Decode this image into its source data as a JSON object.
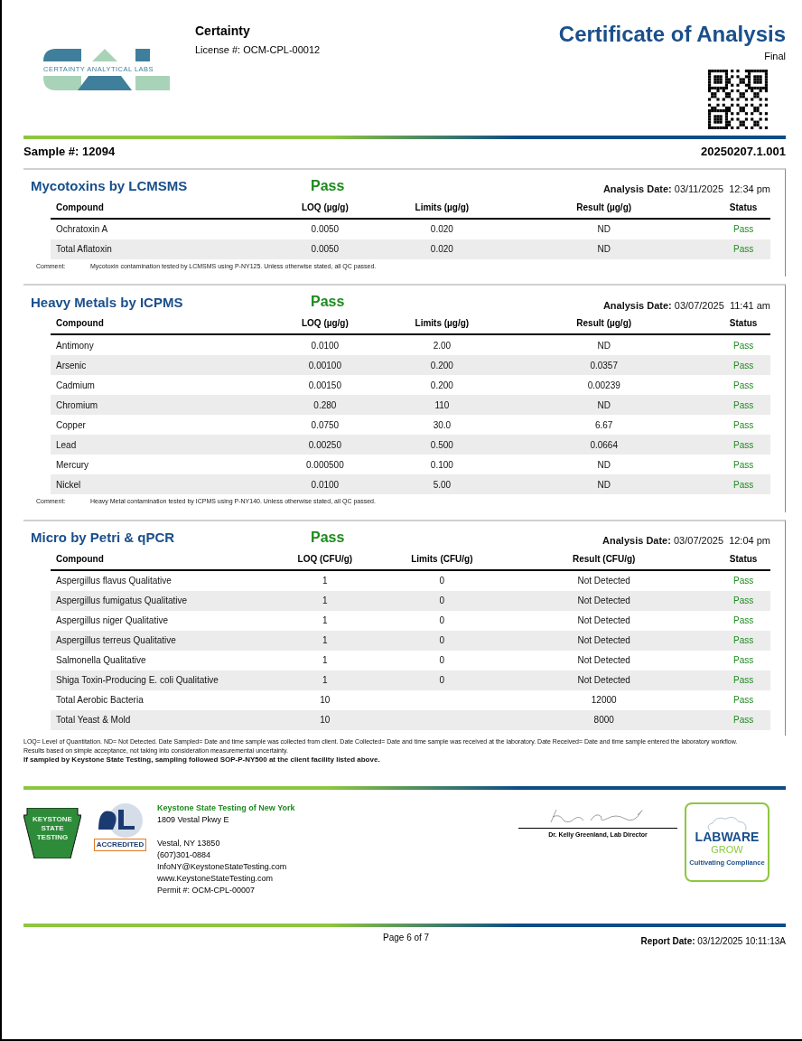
{
  "header": {
    "logo_text": "CERTAINTY ANALYTICAL LABS",
    "company": "Certainty",
    "license": "License #: OCM-CPL-00012",
    "title": "Certificate of Analysis",
    "status": "Final"
  },
  "sample": {
    "label": "Sample #: 12094",
    "id": "20250207.1.001"
  },
  "sections": [
    {
      "title": "Mycotoxins by LCMSMS",
      "result": "Pass",
      "date_label": "Analysis Date:",
      "date": "03/11/2025  12:34 pm",
      "columns": [
        "Compound",
        "LOQ (µg/g)",
        "Limits (µg/g)",
        "Result (µg/g)",
        "Status"
      ],
      "rows": [
        [
          "Ochratoxin A",
          "0.0050",
          "0.020",
          "ND",
          "Pass"
        ],
        [
          "Total Aflatoxin",
          "0.0050",
          "0.020",
          "ND",
          "Pass"
        ]
      ],
      "comment_label": "Comment:",
      "comment": "Mycotoxin contamination tested by LCMSMS using P-NY125. Unless otherwise stated, all QC passed."
    },
    {
      "title": "Heavy Metals by ICPMS",
      "result": "Pass",
      "date_label": "Analysis Date:",
      "date": "03/07/2025  11:41 am",
      "columns": [
        "Compound",
        "LOQ (µg/g)",
        "Limits (µg/g)",
        "Result (µg/g)",
        "Status"
      ],
      "rows": [
        [
          "Antimony",
          "0.0100",
          "2.00",
          "ND",
          "Pass"
        ],
        [
          "Arsenic",
          "0.00100",
          "0.200",
          "0.0357",
          "Pass"
        ],
        [
          "Cadmium",
          "0.00150",
          "0.200",
          "0.00239",
          "Pass"
        ],
        [
          "Chromium",
          "0.280",
          "110",
          "ND",
          "Pass"
        ],
        [
          "Copper",
          "0.0750",
          "30.0",
          "6.67",
          "Pass"
        ],
        [
          "Lead",
          "0.00250",
          "0.500",
          "0.0664",
          "Pass"
        ],
        [
          "Mercury",
          "0.000500",
          "0.100",
          "ND",
          "Pass"
        ],
        [
          "Nickel",
          "0.0100",
          "5.00",
          "ND",
          "Pass"
        ]
      ],
      "comment_label": "Comment:",
      "comment": "Heavy Metal contamination tested by ICPMS using P-NY140. Unless otherwise stated, all QC passed."
    },
    {
      "title": "Micro by Petri & qPCR",
      "result": "Pass",
      "date_label": "Analysis Date:",
      "date": "03/07/2025  12:04 pm",
      "columns": [
        "Compound",
        "LOQ (CFU/g)",
        "Limits (CFU/g)",
        "Result (CFU/g)",
        "Status"
      ],
      "rows": [
        [
          "Aspergillus flavus Qualitative",
          "1",
          "0",
          "Not Detected",
          "Pass"
        ],
        [
          "Aspergillus fumigatus Qualitative",
          "1",
          "0",
          "Not Detected",
          "Pass"
        ],
        [
          "Aspergillus niger Qualitative",
          "1",
          "0",
          "Not Detected",
          "Pass"
        ],
        [
          "Aspergillus terreus Qualitative",
          "1",
          "0",
          "Not Detected",
          "Pass"
        ],
        [
          "Salmonella Qualitative",
          "1",
          "0",
          "Not Detected",
          "Pass"
        ],
        [
          "Shiga Toxin-Producing E. coli Qualitative",
          "1",
          "0",
          "Not Detected",
          "Pass"
        ],
        [
          "Total Aerobic Bacteria",
          "10",
          "",
          "12000",
          "Pass"
        ],
        [
          "Total Yeast & Mold",
          "10",
          "",
          "8000",
          "Pass"
        ]
      ]
    }
  ],
  "notes": [
    "LOQ= Level of Quantitation. ND= Not Detected. Date Sampled= Date and time sample was collected from client. Date Collected= Date and time sample was received at the laboratory. Date Received= Date and time sample entered the laboratory workflow.",
    "Results based on simple acceptance, not taking into consideration measurementai uncertainty."
  ],
  "sampling_note": "If sampled by Keystone State Testing, sampling followed SOP-P-NY500 at the client facility listed above.",
  "lab": {
    "badge_text": "KEYSTONE STATE TESTING",
    "accredited": "ACCREDITED",
    "name": "Keystone State Testing of New York",
    "address_blocks": [
      [
        "1809 Vestal Pkwy E"
      ],
      [
        "Vestal, NY  13850",
        "(607)301-0884",
        "InfoNY@KeystoneStateTesting.com",
        "www.KeystoneStateTesting.com",
        "Permit #: OCM-CPL-00007"
      ]
    ]
  },
  "signer": "Dr. Kelly Greenland, Lab Director",
  "partner": {
    "name": "LABWARE",
    "sub": "GROW",
    "tagline": "Cultivating Compliance"
  },
  "footer": {
    "page": "Page 6 of 7",
    "report_label": "Report Date:",
    "report_date": "03/12/2025 10:11:13A"
  }
}
